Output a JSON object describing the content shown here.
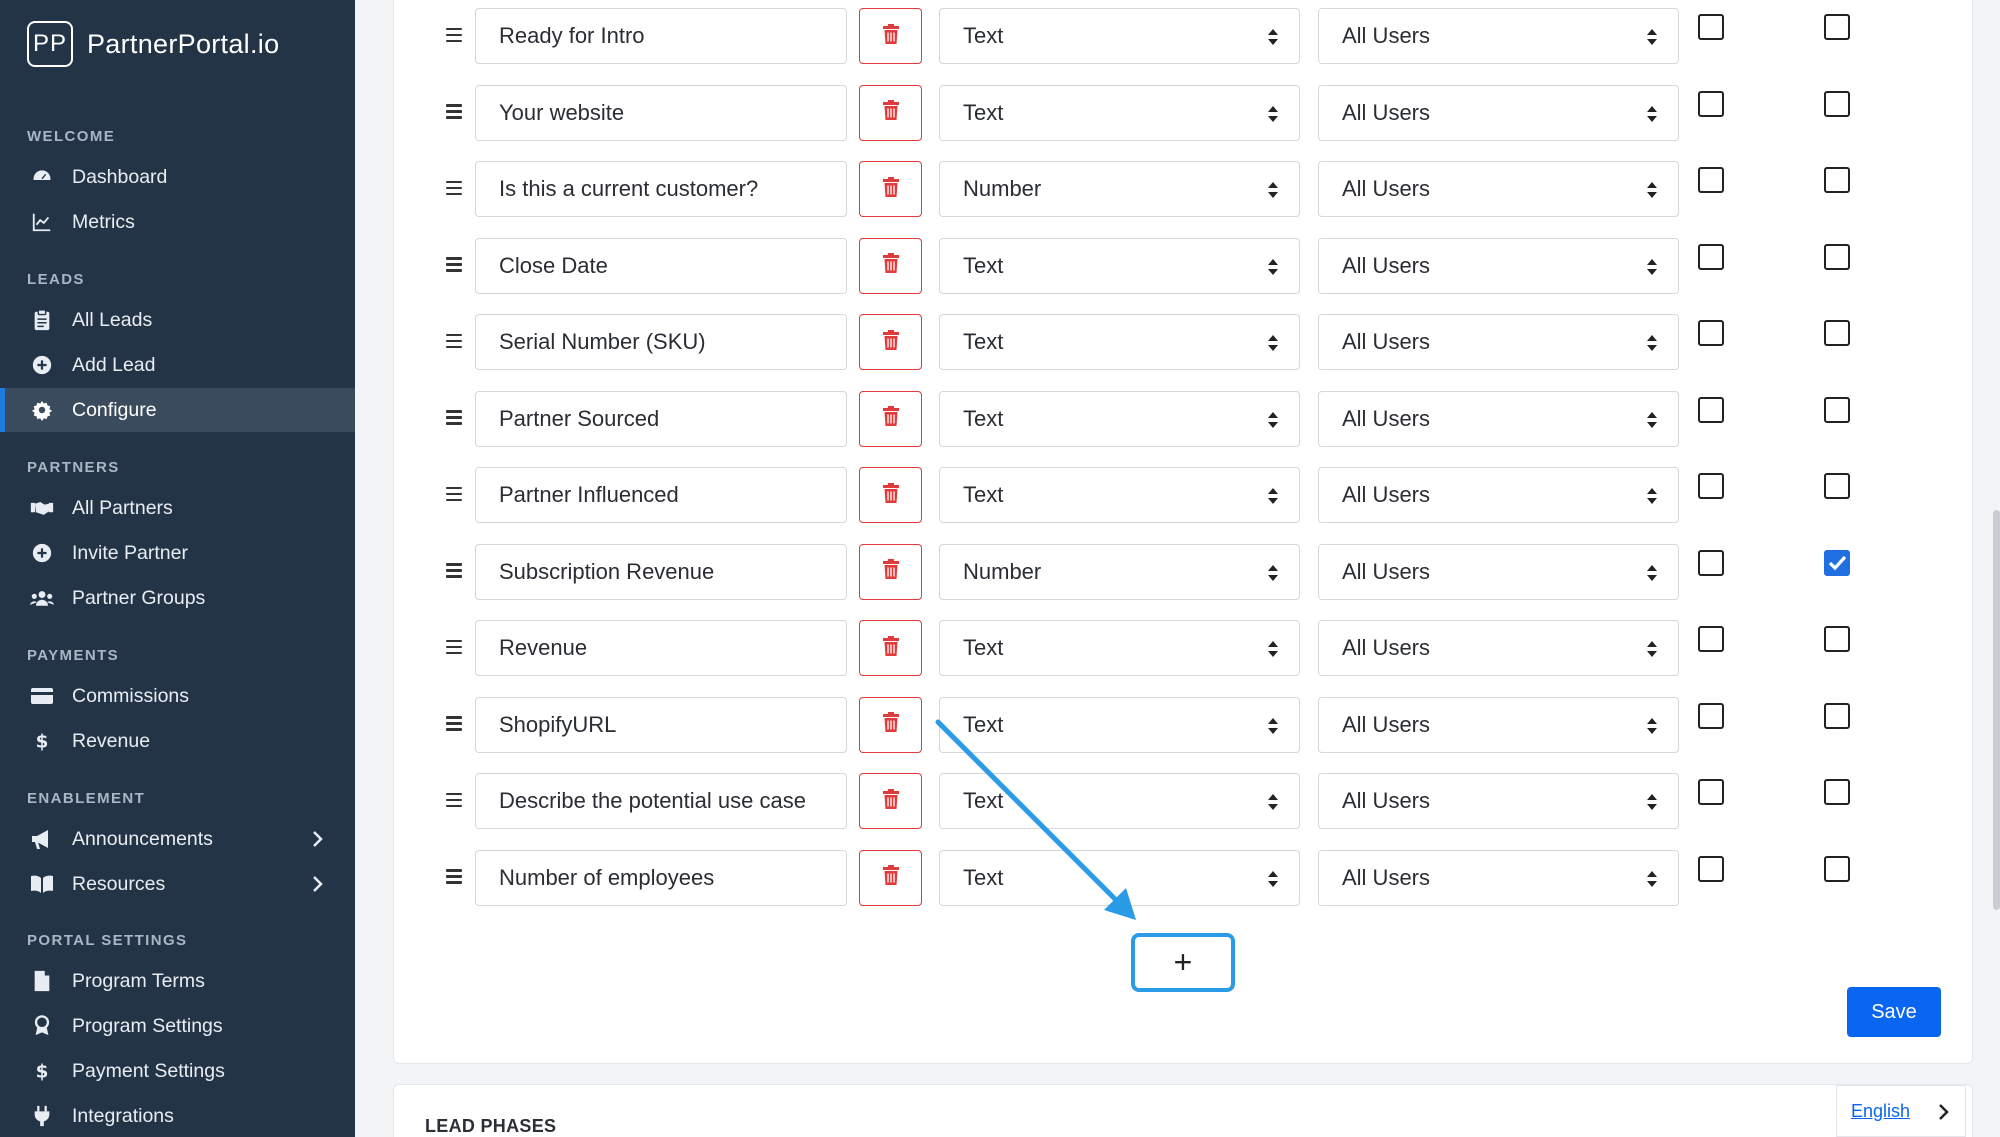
{
  "brand": {
    "logo": "PP",
    "name": "PartnerPortal.io"
  },
  "sidebar": {
    "sections": [
      {
        "title": "WELCOME",
        "items": [
          {
            "label": "Dashboard",
            "icon": "gauge-icon"
          },
          {
            "label": "Metrics",
            "icon": "chart-line-icon"
          }
        ]
      },
      {
        "title": "LEADS",
        "items": [
          {
            "label": "All Leads",
            "icon": "clipboard-icon"
          },
          {
            "label": "Add Lead",
            "icon": "plus-circle-icon"
          },
          {
            "label": "Configure",
            "icon": "gear-icon",
            "active": true
          }
        ]
      },
      {
        "title": "PARTNERS",
        "items": [
          {
            "label": "All Partners",
            "icon": "handshake-icon"
          },
          {
            "label": "Invite Partner",
            "icon": "plus-circle-icon"
          },
          {
            "label": "Partner Groups",
            "icon": "users-icon"
          }
        ]
      },
      {
        "title": "PAYMENTS",
        "items": [
          {
            "label": "Commissions",
            "icon": "credit-card-icon"
          },
          {
            "label": "Revenue",
            "icon": "dollar-icon"
          }
        ]
      },
      {
        "title": "ENABLEMENT",
        "items": [
          {
            "label": "Announcements",
            "icon": "megaphone-icon"
          },
          {
            "label": "Resources",
            "icon": "book-icon"
          }
        ]
      },
      {
        "title": "PORTAL SETTINGS",
        "items": [
          {
            "label": "Program Terms",
            "icon": "file-icon"
          },
          {
            "label": "Program Settings",
            "icon": "award-icon"
          },
          {
            "label": "Payment Settings",
            "icon": "dollar-icon"
          },
          {
            "label": "Integrations",
            "icon": "plug-icon"
          }
        ]
      }
    ]
  },
  "fields": [
    {
      "name": "Ready for Intro",
      "type": "Text",
      "visibility": "All Users",
      "check1": false,
      "check2": false
    },
    {
      "name": "Your website",
      "type": "Text",
      "visibility": "All Users",
      "check1": false,
      "check2": false
    },
    {
      "name": "Is this a current customer?",
      "type": "Number",
      "visibility": "All Users",
      "check1": false,
      "check2": false
    },
    {
      "name": "Close Date",
      "type": "Text",
      "visibility": "All Users",
      "check1": false,
      "check2": false
    },
    {
      "name": "Serial Number (SKU)",
      "type": "Text",
      "visibility": "All Users",
      "check1": false,
      "check2": false
    },
    {
      "name": "Partner Sourced",
      "type": "Text",
      "visibility": "All Users",
      "check1": false,
      "check2": false
    },
    {
      "name": "Partner Influenced",
      "type": "Text",
      "visibility": "All Users",
      "check1": false,
      "check2": false
    },
    {
      "name": "Subscription Revenue",
      "type": "Number",
      "visibility": "All Users",
      "check1": false,
      "check2": true
    },
    {
      "name": "Revenue",
      "type": "Text",
      "visibility": "All Users",
      "check1": false,
      "check2": false
    },
    {
      "name": "ShopifyURL",
      "type": "Text",
      "visibility": "All Users",
      "check1": false,
      "check2": false
    },
    {
      "name": "Describe the potential use case",
      "type": "Text",
      "visibility": "All Users",
      "check1": false,
      "check2": false
    },
    {
      "name": "Number of employees",
      "type": "Text",
      "visibility": "All Users",
      "check1": false,
      "check2": false
    }
  ],
  "actions": {
    "add_label": "+",
    "save_label": "Save"
  },
  "next_section": {
    "title": "LEAD PHASES"
  },
  "language": {
    "label": "English"
  },
  "colors": {
    "sidebar_bg": "#243447",
    "accent": "#0a66f0",
    "danger": "#e03a3a",
    "highlight": "#2a9be6"
  }
}
